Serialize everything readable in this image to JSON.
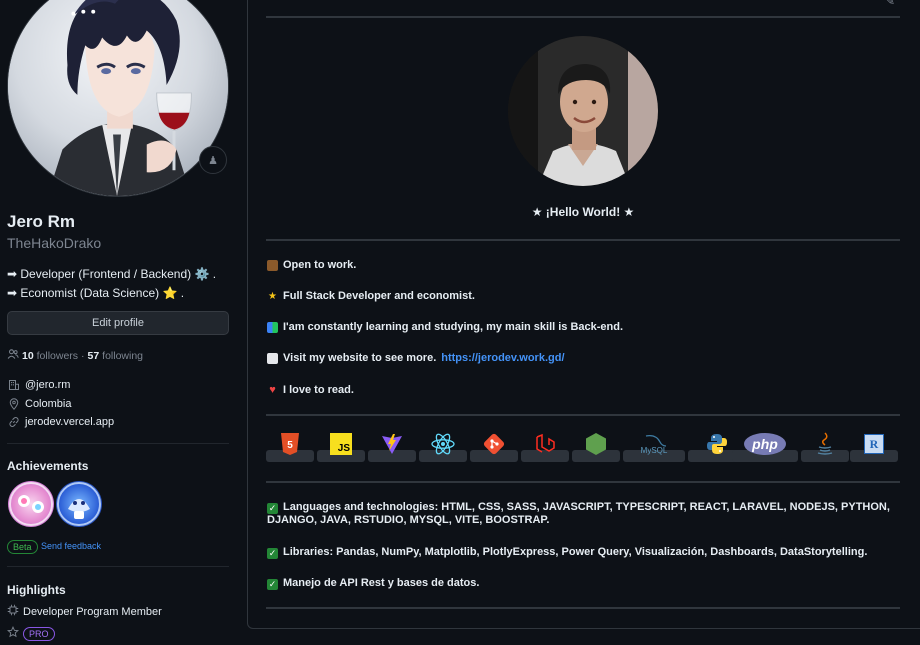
{
  "profile": {
    "name": "Jero Rm",
    "login": "TheHakoDrako",
    "bio_line1": "➡ Developer (Frontend / Backend) ⚙️ .",
    "bio_line2": "➡ Economist (Data Science) ⭐ .",
    "edit_label": "Edit profile",
    "followers_count": "10",
    "followers_label": "followers",
    "separator": "·",
    "following_count": "57",
    "following_label": "following",
    "company": "@jero.rm",
    "location": "Colombia",
    "website": "jerodev.vercel.app"
  },
  "achievements": {
    "title": "Achievements",
    "badges": [
      "yolo-badge",
      "pull-shark-badge"
    ],
    "beta_label": "Beta",
    "feedback_label": "Send feedback"
  },
  "highlights": {
    "title": "Highlights",
    "item1": "Developer Program Member",
    "pro_label": "PRO"
  },
  "readme": {
    "hello": "★ ¡Hello World! ★",
    "line1": "Open to work.",
    "line2": "Full Stack Developer and economist.",
    "line3": "I'am constantly learning and studying, my main skill is Back-end.",
    "line4_text": "Visit my website to see more.",
    "line4_link": "https://jerodev.work.gd/",
    "line5": "I love to read.",
    "tech_icons": [
      "html5-icon",
      "javascript-icon",
      "vite-icon",
      "react-icon",
      "git-icon",
      "laravel-icon",
      "nodejs-icon",
      "mysql-icon",
      "python-icon",
      "php-icon",
      "java-icon",
      "r-icon"
    ],
    "tech_text": {
      "js": "JS",
      "php": "php",
      "mysql": "MySQL",
      "r": "R",
      "html_num": "5"
    },
    "para1": "Languages and technologies: HTML, CSS, SASS, JAVASCRIPT, TYPESCRIPT, REACT, LARAVEL, NODEJS, PYTHON, DJANGO, JAVA, RSTUDIO, MYSQL, VITE, BOOSTRAP.",
    "para2": "Libraries: Pandas, NumPy, Matplotlib, PlotlyExpress, Power Query, Visualización, Dashboards, DataStorytelling.",
    "para3": "Manejo de API Rest y bases de datos."
  },
  "colors": {
    "background": "#0d1117",
    "accent_link": "#4493f8",
    "check_green": "#238636",
    "pro_purple": "#a371f7"
  }
}
